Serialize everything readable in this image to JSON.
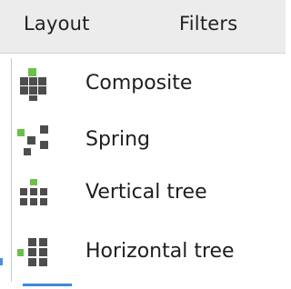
{
  "menubar": {
    "layout_label": "Layout",
    "filters_label": "Filters"
  },
  "layout_menu": {
    "items": [
      {
        "label": "Composite",
        "icon": "composite-layout-icon"
      },
      {
        "label": "Spring",
        "icon": "spring-layout-icon"
      },
      {
        "label": "Vertical tree",
        "icon": "vertical-tree-icon"
      },
      {
        "label": "Horizontal tree",
        "icon": "horizontal-tree-icon"
      }
    ]
  },
  "colors": {
    "menubar_bg": "#ececec",
    "node_dark": "#4d4d4d",
    "node_green": "#6cc04a",
    "accent_blue": "#3c8ad8"
  }
}
